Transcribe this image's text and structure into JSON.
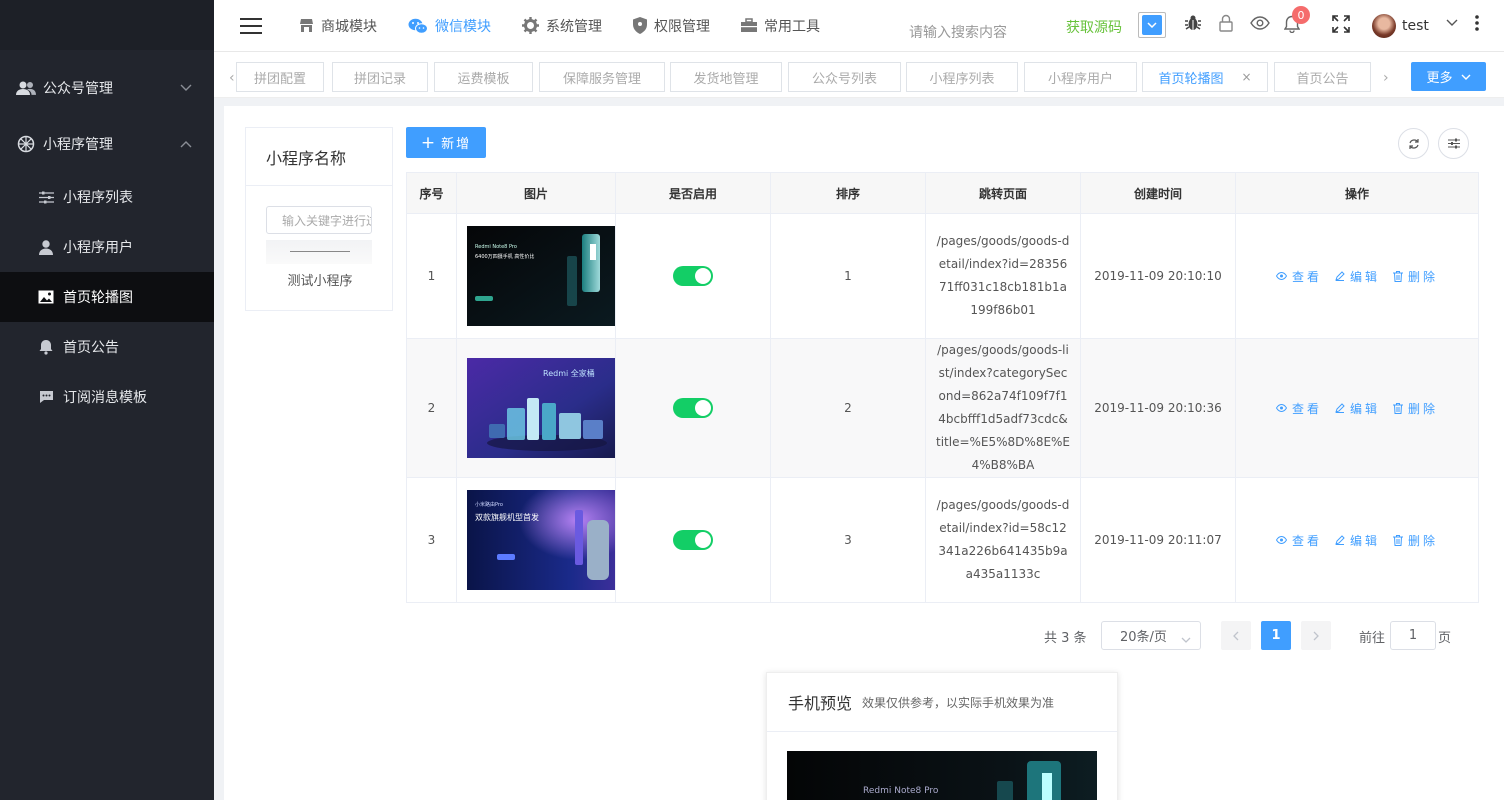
{
  "sidebar": {
    "groups": [
      {
        "label": "公众号管理",
        "icon": "users-icon"
      },
      {
        "label": "小程序管理",
        "icon": "aperture-icon"
      }
    ],
    "items": [
      {
        "label": "小程序列表",
        "icon": "sliders-icon"
      },
      {
        "label": "小程序用户",
        "icon": "user-icon"
      },
      {
        "label": "首页轮播图",
        "icon": "picture-icon",
        "active": true
      },
      {
        "label": "首页公告",
        "icon": "bell-icon"
      },
      {
        "label": "订阅消息模板",
        "icon": "message-icon"
      }
    ]
  },
  "header": {
    "nav": [
      {
        "label": "商城模块",
        "icon": "shop-icon"
      },
      {
        "label": "微信模块",
        "icon": "wechat-icon",
        "active": true
      },
      {
        "label": "系统管理",
        "icon": "gear-icon"
      },
      {
        "label": "权限管理",
        "icon": "shield-icon"
      },
      {
        "label": "常用工具",
        "icon": "toolbox-icon"
      }
    ],
    "search_placeholder": "请输入搜索内容",
    "get_source": "获取源码",
    "notification_count": "0",
    "username": "test",
    "accent": "#409eff"
  },
  "tabs": {
    "items": [
      "拼团配置",
      "拼团记录",
      "运费模板",
      "保障服务管理",
      "发货地管理",
      "公众号列表",
      "小程序列表",
      "小程序用户",
      "首页轮播图",
      "首页公告"
    ],
    "active_index": 8,
    "close_mark": "×",
    "more_label": "更多"
  },
  "miniapp_panel": {
    "title": "小程序名称",
    "search_placeholder": "输入关键字进行过滤",
    "items": [
      "测试小程序"
    ]
  },
  "toolbar": {
    "add_label": "新增"
  },
  "table": {
    "columns": [
      "序号",
      "图片",
      "是否启用",
      "排序",
      "跳转页面",
      "创建时间",
      "操作"
    ],
    "actions": [
      "查看",
      "编辑",
      "删除"
    ],
    "rows": [
      {
        "no": "1",
        "enabled": true,
        "sort": "1",
        "url": "/pages/goods/goods-detail/index?id=2835671ff031c18cb181b1a199f86b01",
        "created": "2019-11-09 20:10:10",
        "image_lines": [
          "Redmi Note8 Pro",
          "6400万四摄手机 高性价比"
        ]
      },
      {
        "no": "2",
        "enabled": true,
        "sort": "2",
        "url": "/pages/goods/goods-list/index?categorySecond=862a74f109f7f14bcbfff1d5adf73cdc&title=%E5%8D%8E%E4%B8%BA",
        "created": "2019-11-09 20:10:36",
        "image_lines": [
          "Redmi 全家桶"
        ]
      },
      {
        "no": "3",
        "enabled": true,
        "sort": "3",
        "url": "/pages/goods/goods-detail/index?id=58c12341a226b641435b9aa435a1133c",
        "created": "2019-11-09 20:11:07",
        "image_lines": [
          "小米路由Pro",
          "双款旗舰机型首发"
        ]
      }
    ]
  },
  "pagination": {
    "total": "共 3 条",
    "page_size": "20条/页",
    "current": "1",
    "goto_label": "前往",
    "goto_value": "1",
    "page_unit": "页"
  },
  "phone_preview": {
    "title": "手机预览",
    "note": "效果仅供参考，以实际手机效果为准",
    "image_text": "Redmi Note8 Pro"
  }
}
